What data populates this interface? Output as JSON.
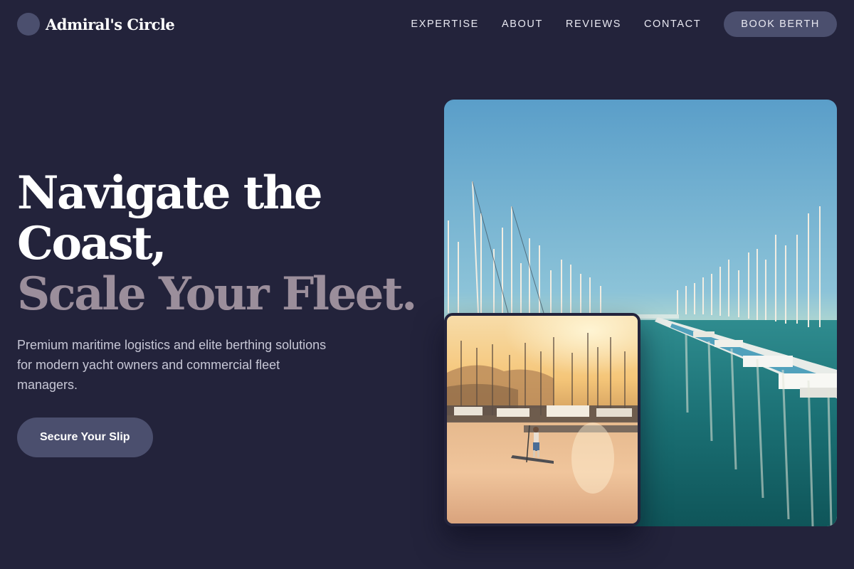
{
  "header": {
    "brand_name": "Admiral's Circle",
    "logo_icon": "circle-logo-icon",
    "nav": [
      {
        "label": "EXPERTISE"
      },
      {
        "label": "ABOUT"
      },
      {
        "label": "REVIEWS"
      },
      {
        "label": "CONTACT"
      }
    ],
    "cta_label": "BOOK BERTH"
  },
  "hero": {
    "headline_line1": "Navigate the",
    "headline_line2": "Coast,",
    "headline_accent": "Scale Your Fleet.",
    "subtext": "Premium maritime logistics and elite berthing solutions for modern yacht owners and commercial fleet managers.",
    "cta_label": "Secure Your Slip"
  },
  "colors": {
    "background": "#23233b",
    "accent_button": "#4b4f6e",
    "headline_accent": "#9b8e9b",
    "body_text": "#c7c7d6"
  }
}
